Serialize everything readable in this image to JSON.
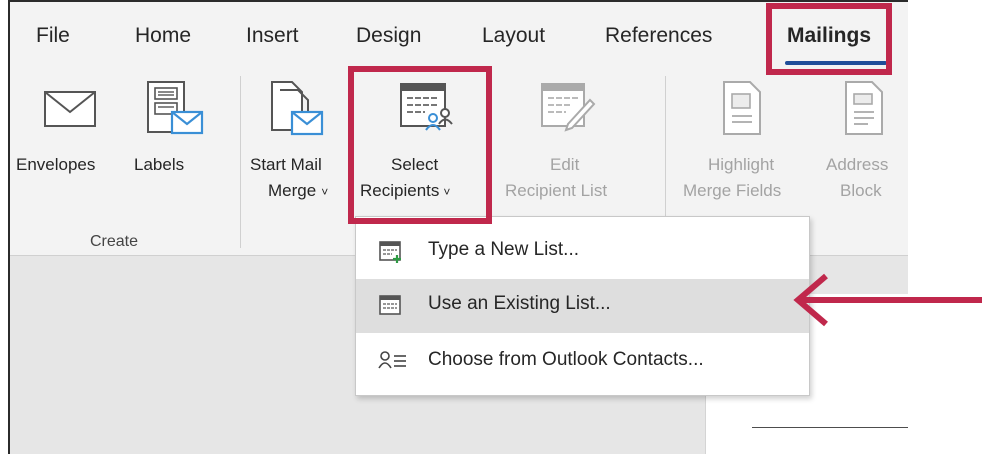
{
  "tabs": [
    "File",
    "Home",
    "Insert",
    "Design",
    "Layout",
    "References",
    "Mailings"
  ],
  "active_tab": "Mailings",
  "ribbon": {
    "envelopes": "Envelopes",
    "labels": "Labels",
    "create_group": "Create",
    "start_mail_merge": [
      "Start Mail",
      "Merge"
    ],
    "select_recipients": [
      "Select",
      "Recipients"
    ],
    "edit_recipient_list": [
      "Edit",
      "Recipient List"
    ],
    "highlight_merge_fields": [
      "Highlight",
      "Merge Fields"
    ],
    "address_block": [
      "Address",
      "Block"
    ]
  },
  "menu": {
    "items": [
      "Type a New List...",
      "Use an Existing List...",
      "Choose from Outlook Contacts..."
    ],
    "highlighted_index": 1
  },
  "colors": {
    "annotation": "#c0284c",
    "active_tab_underline": "#1f4e99",
    "icon_blue": "#3a8fd6"
  }
}
